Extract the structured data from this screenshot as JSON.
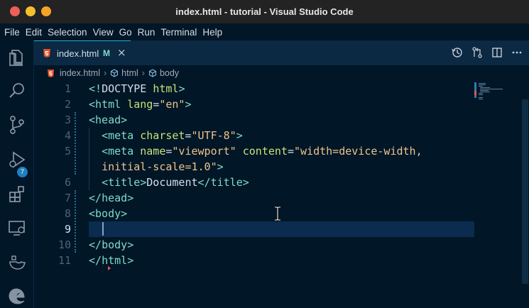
{
  "window": {
    "title": "index.html - tutorial - Visual Studio Code"
  },
  "menu": [
    "File",
    "Edit",
    "Selection",
    "View",
    "Go",
    "Run",
    "Terminal",
    "Help"
  ],
  "activity_bar": {
    "items": [
      "explorer-icon",
      "search-icon",
      "source-control-icon",
      "run-debug-icon",
      "extensions-icon",
      "remote-explorer-icon",
      "docker-icon",
      "edge-devtools-icon"
    ],
    "source_control_badge": "7"
  },
  "tab": {
    "label": "index.html",
    "status": "M",
    "close": "×"
  },
  "tab_actions": [
    "timeline-icon",
    "compare-changes-icon",
    "split-editor-icon",
    "more-actions-icon"
  ],
  "breadcrumb": [
    "index.html",
    "html",
    "body"
  ],
  "editor": {
    "line_numbers": [
      "1",
      "2",
      "3",
      "4",
      "5",
      "",
      "6",
      "7",
      "8",
      "9",
      "10",
      "11"
    ],
    "current_line": "9"
  },
  "colors": {
    "background": "#011627",
    "tag_punct": "#7fdbca",
    "attribute": "#c5e478",
    "string": "#ecc48d",
    "text": "#d6deeb"
  }
}
